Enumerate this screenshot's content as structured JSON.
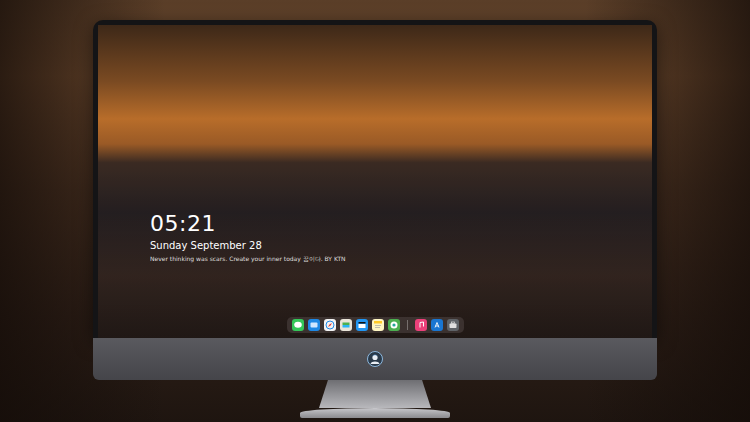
{
  "lock_screen": {
    "time": "05:21",
    "date": "Sunday September 28",
    "caption": "Never thinking was scars. Create your inner today 꿈이다. BY KTN"
  },
  "dock": {
    "apps": [
      {
        "kind": "messages"
      },
      {
        "kind": "files"
      },
      {
        "kind": "safari"
      },
      {
        "kind": "folder"
      },
      {
        "kind": "clapper"
      },
      {
        "kind": "notes"
      },
      {
        "kind": "photos"
      },
      {
        "kind": "separator"
      },
      {
        "kind": "music"
      },
      {
        "kind": "appstore"
      },
      {
        "kind": "briefcase"
      }
    ]
  }
}
